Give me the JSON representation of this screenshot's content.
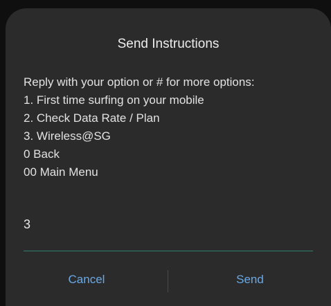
{
  "dialog": {
    "title": "Send Instructions",
    "message_lines": [
      "Reply with your option or # for more options:",
      "1. First time surfing on your mobile",
      "2. Check Data Rate / Plan",
      "3. Wireless@SG",
      "0 Back",
      "00 Main Menu"
    ],
    "input": {
      "value": "3",
      "placeholder": ""
    },
    "buttons": {
      "cancel_label": "Cancel",
      "send_label": "Send"
    },
    "colors": {
      "background": "#2b2b2b",
      "accent": "#6aa8e6",
      "input_underline": "#2e7f6d"
    }
  }
}
